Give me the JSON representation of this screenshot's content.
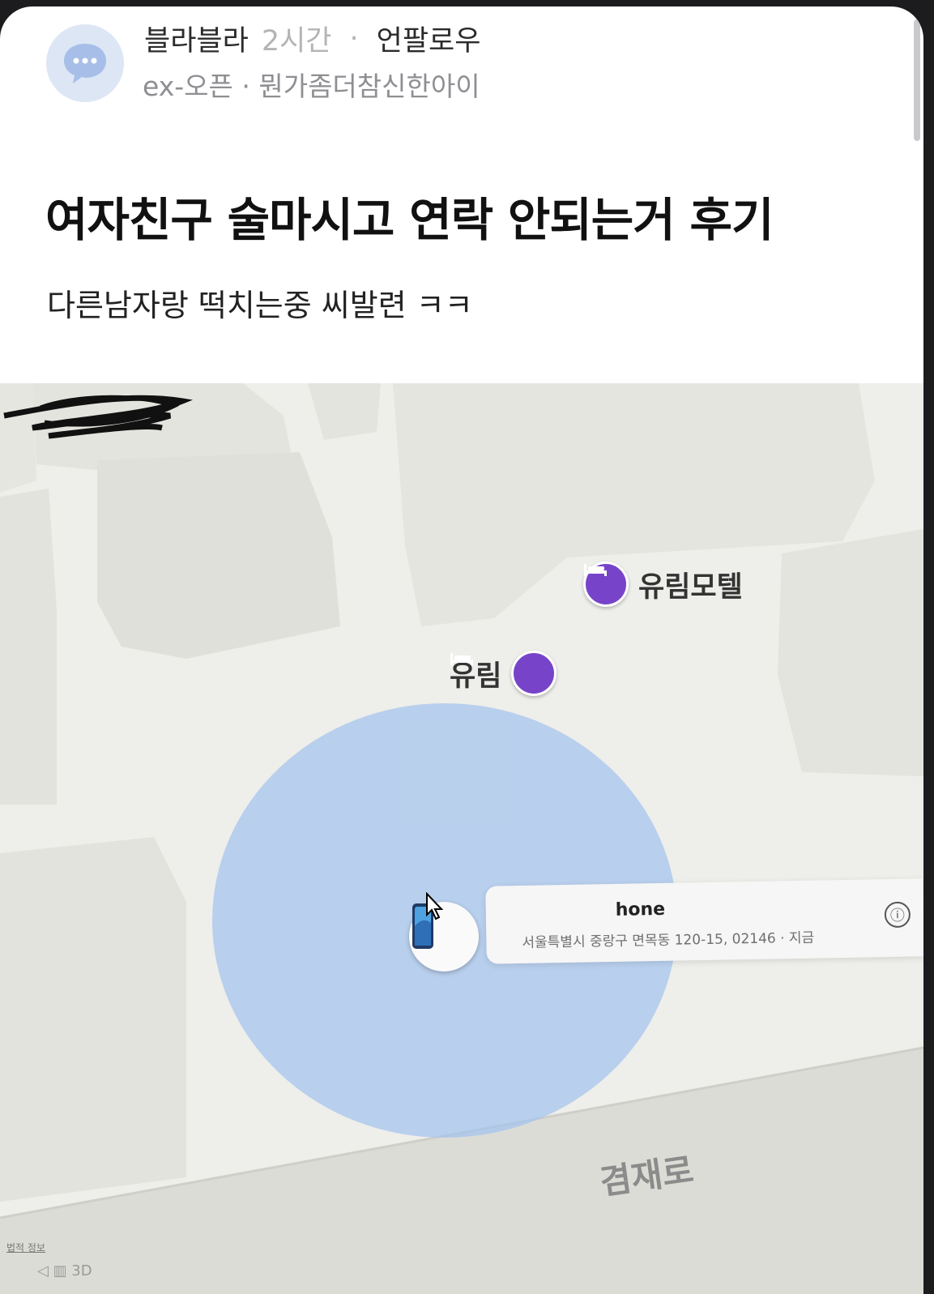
{
  "post": {
    "author": "블라블라",
    "time": "2시간",
    "separator": "·",
    "follow_label": "언팔로우",
    "board": "ex-오픈 · 뭔가좀더참신한아이",
    "title": "여자친구 술마시고 연락 안되는거 후기",
    "body": "다른남자랑 떡치는중 씨발련 ㅋㅋ"
  },
  "map": {
    "poi_1": "유림모텔",
    "poi_2": "유림",
    "device_name": "hone",
    "device_address": "서울특별시 중랑구 면목동 120-15, 02146 · 지금",
    "road_name": "겸재로",
    "legal": "법적 정보",
    "info_icon": "ⓘ",
    "bottom_controls": "◁  ▥  3D"
  },
  "colors": {
    "poi": "#7744c9",
    "radius": "#a4c4ee",
    "map_bg": "#eeeeea"
  }
}
